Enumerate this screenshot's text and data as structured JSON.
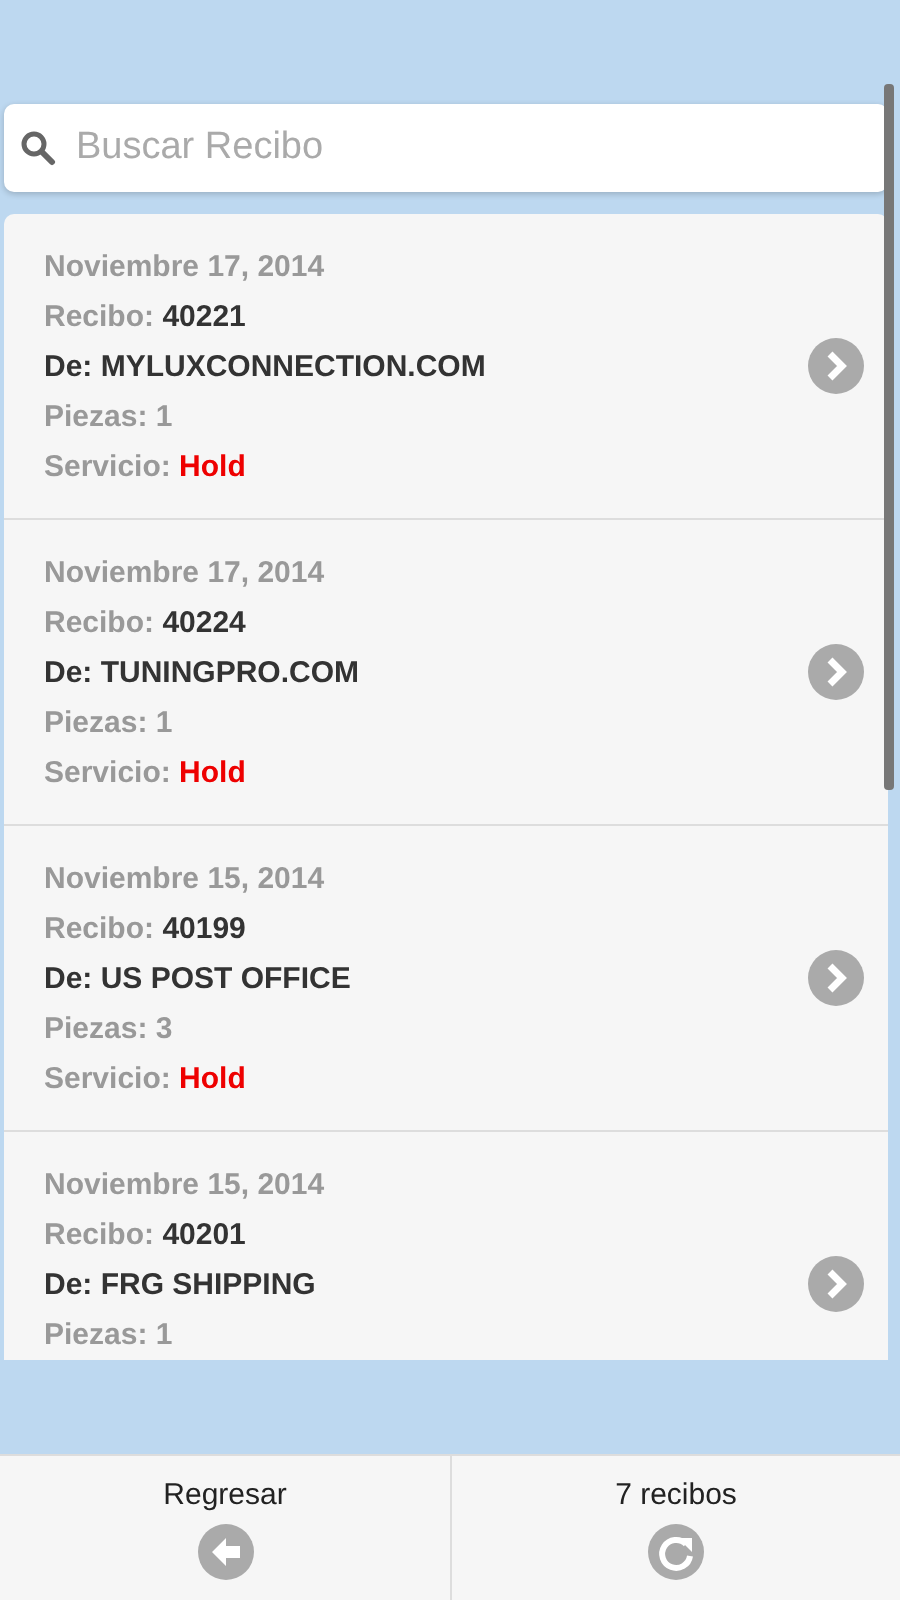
{
  "search": {
    "placeholder": "Buscar Recibo"
  },
  "receipts": [
    {
      "date": "Noviembre 17, 2014",
      "receipt_label": "Recibo:",
      "receipt": "40221",
      "from": "De: MYLUXCONNECTION.COM",
      "pieces": "Piezas: 1",
      "service_label": "Servicio:",
      "service": "Hold"
    },
    {
      "date": "Noviembre 17, 2014",
      "receipt_label": "Recibo:",
      "receipt": "40224",
      "from": "De: TUNINGPRO.COM",
      "pieces": "Piezas: 1",
      "service_label": "Servicio:",
      "service": "Hold"
    },
    {
      "date": "Noviembre 15, 2014",
      "receipt_label": "Recibo:",
      "receipt": "40199",
      "from": "De: US POST OFFICE",
      "pieces": "Piezas: 3",
      "service_label": "Servicio:",
      "service": "Hold"
    },
    {
      "date": "Noviembre 15, 2014",
      "receipt_label": "Recibo:",
      "receipt": "40201",
      "from": "De: FRG SHIPPING",
      "pieces": "Piezas: 1"
    }
  ],
  "footer": [
    {
      "kind": "back",
      "label": "Regresar"
    },
    {
      "kind": "refresh",
      "label": "7 recibos"
    }
  ]
}
